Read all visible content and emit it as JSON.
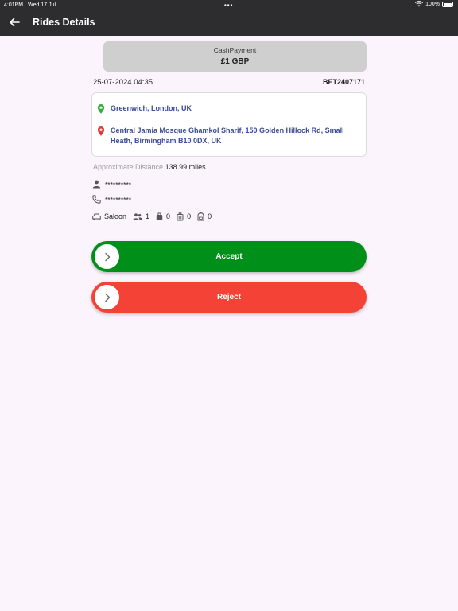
{
  "status_bar": {
    "time": "4:01PM",
    "date": "Wed 17 Jul",
    "battery": "100%",
    "icons": [
      "wifi-icon",
      "battery-icon"
    ]
  },
  "app_bar": {
    "title": "Rides Details",
    "back_icon": "arrow-left-icon"
  },
  "payment": {
    "type": "CashPayment",
    "amount": "£1 GBP"
  },
  "ride": {
    "datetime": "25-07-2024 04:35",
    "booking_ref": "BET2407171",
    "pickup": "Greenwich, London, UK",
    "dropoff": "Central Jamia Mosque Ghamkol Sharif, 150 Golden Hillock Rd, Small Heath, Birmingham B10 0DX, UK",
    "distance_label": "Approximate Distance",
    "distance_value": "138.99 miles",
    "passenger_name": "**********",
    "passenger_phone": "**********",
    "vehicle": "Saloon",
    "passengers": "1",
    "luggage": "0",
    "suitcases": "0",
    "hand_luggage": "0"
  },
  "actions": {
    "accept_label": "Accept",
    "reject_label": "Reject"
  },
  "colors": {
    "app_bar": "#2d2d2f",
    "background": "#fbf4fd",
    "accept": "#00901a",
    "reject": "#f44236",
    "pickup_pin": "#3aaa3a",
    "dropoff_pin": "#e23a3a",
    "address_text": "#3a4a9a"
  }
}
